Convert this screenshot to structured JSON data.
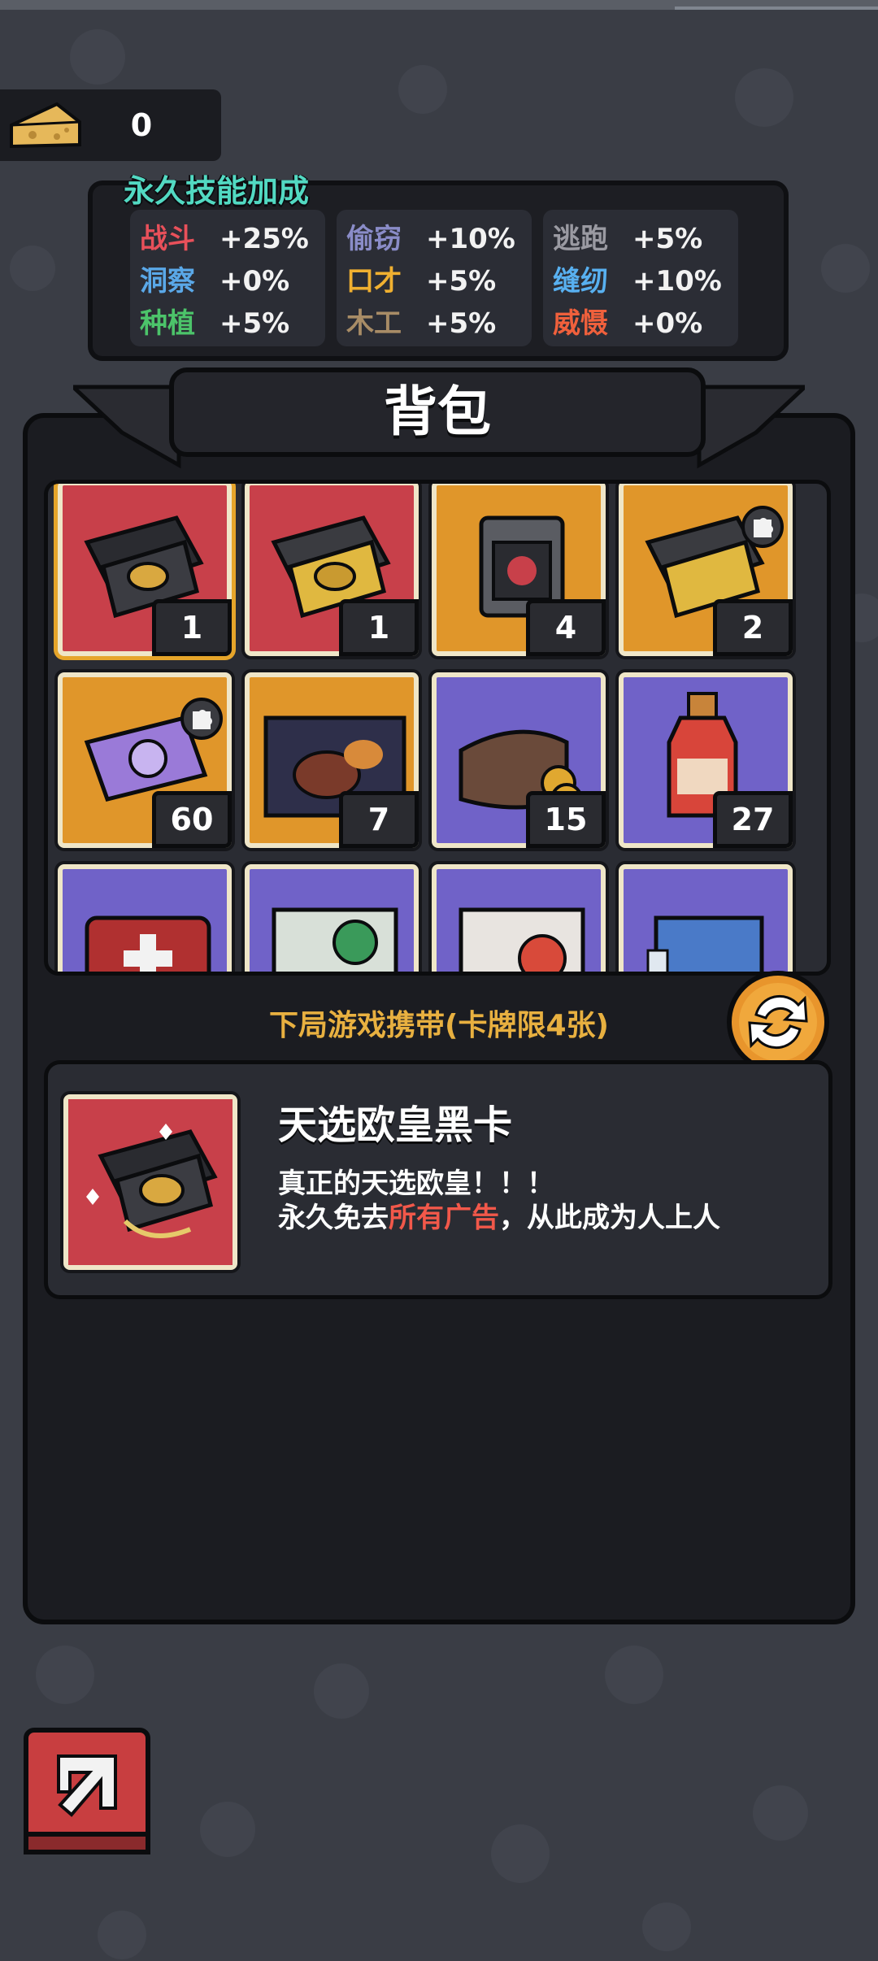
{
  "currency": {
    "icon": "cheese-icon",
    "value": "0"
  },
  "skills": {
    "title": "永久技能加成",
    "columns": [
      [
        {
          "name": "战斗",
          "value": "+25%",
          "color": "#e8505a"
        },
        {
          "name": "洞察",
          "value": "+0%",
          "color": "#5aa8e8"
        },
        {
          "name": "种植",
          "value": "+5%",
          "color": "#4cc46a"
        }
      ],
      [
        {
          "name": "偷窃",
          "value": "+10%",
          "color": "#8a8cc8"
        },
        {
          "name": "口才",
          "value": "+5%",
          "color": "#f0b030"
        },
        {
          "name": "木工",
          "value": "+5%",
          "color": "#a88c66"
        }
      ],
      [
        {
          "name": "逃跑",
          "value": "+5%",
          "color": "#9a9aa2"
        },
        {
          "name": "缝纫",
          "value": "+10%",
          "color": "#58b0f0"
        },
        {
          "name": "威慑",
          "value": "+0%",
          "color": "#f0603c"
        }
      ]
    ]
  },
  "bag": {
    "title": "背包",
    "items": [
      {
        "name": "黑卡礼盒",
        "count": "1",
        "bg": "#c8404a",
        "selected": true,
        "puzzle": false
      },
      {
        "name": "金卡礼盒",
        "count": "1",
        "bg": "#c8404a",
        "selected": false,
        "puzzle": false
      },
      {
        "name": "包装物品",
        "count": "4",
        "bg": "#e0962a",
        "selected": false,
        "puzzle": false
      },
      {
        "name": "金卡礼盒碎片",
        "count": "2",
        "bg": "#e0962a",
        "selected": false,
        "puzzle": true
      },
      {
        "name": "紫卡碎片",
        "count": "60",
        "bg": "#e0962a",
        "selected": false,
        "puzzle": true
      },
      {
        "name": "牛排套餐",
        "count": "7",
        "bg": "#e0962a",
        "selected": false,
        "puzzle": false
      },
      {
        "name": "钱包",
        "count": "15",
        "bg": "#7062c8",
        "selected": false,
        "puzzle": false
      },
      {
        "name": "番茄酱",
        "count": "27",
        "bg": "#7062c8",
        "selected": false,
        "puzzle": false
      },
      {
        "name": "急救包",
        "count": "",
        "bg": "#7062c8",
        "selected": false,
        "puzzle": false
      },
      {
        "name": "病毒盒",
        "count": "",
        "bg": "#7062c8",
        "selected": false,
        "puzzle": false
      },
      {
        "name": "火焰物品",
        "count": "",
        "bg": "#7062c8",
        "selected": false,
        "puzzle": false
      },
      {
        "name": "药品",
        "count": "",
        "bg": "#7062c8",
        "selected": false,
        "puzzle": false
      }
    ],
    "carry_text": "下局游戏携带(卡牌限4张)",
    "detail": {
      "name": "天选欧皇黑卡",
      "desc_line1": "真正的天选欧皇！！！",
      "desc_line2_a": "永久免去",
      "desc_line2_b": "所有广告",
      "desc_line2_c": "，从此成为人上人"
    }
  }
}
